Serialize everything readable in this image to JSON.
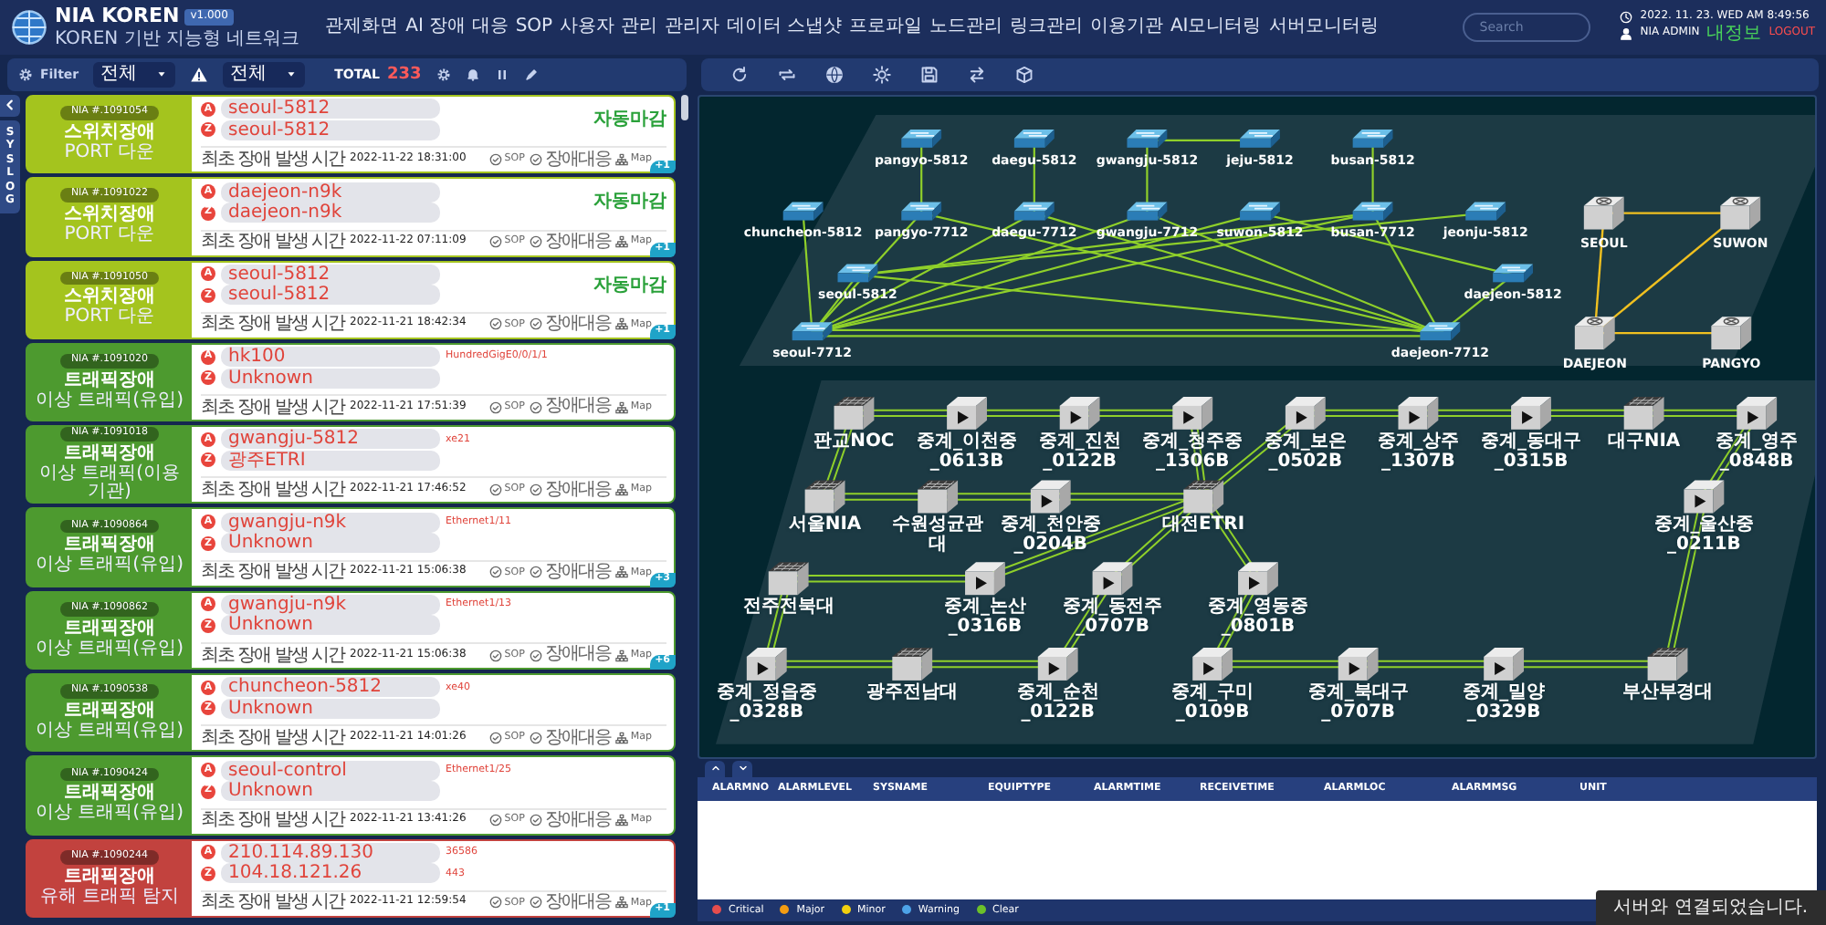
{
  "header": {
    "logo": "NIA KOREN",
    "version": "v1.000",
    "subtitle": "KOREN 기반 지능형 네트워크",
    "menu": [
      "관제화면",
      "AI 장애 대응",
      "SOP",
      "사용자 관리",
      "관리자",
      "데이터 스냅샷",
      "프로파일",
      "노드관리",
      "링크관리",
      "이용기관",
      "AI모니터링",
      "서버모니터링"
    ],
    "search": {
      "placeholder": "Search"
    },
    "datetime": "2022. 11. 23. WED AM 8:49:56",
    "user": "NIA ADMIN",
    "profile_link": "내정보",
    "logout": "LOGOUT"
  },
  "toolbar": {
    "filter": "Filter",
    "select_1": "전체",
    "select_2": "전체",
    "total_label": "TOTAL",
    "total": "233"
  },
  "sidebar": {
    "syslog": "SYSLOG"
  },
  "alarms": [
    {
      "id": "NIA #.1091054",
      "type": "스위치장애",
      "cause": "PORT 다운",
      "color": "#a4c41e",
      "endpoints": [
        {
          "marker": "A",
          "name": "seoul-5812"
        },
        {
          "marker": "Z",
          "name": "seoul-5812"
        }
      ],
      "status": "자동마감",
      "time_label": "최초 장애 발생 시간",
      "time": "2022-11-22 18:31:00",
      "actions": [
        {
          "kind": "sop",
          "label": "SOP"
        },
        {
          "kind": "response",
          "label": "장애대응"
        },
        {
          "kind": "map",
          "label": "Map"
        }
      ],
      "badge": "+1"
    },
    {
      "id": "NIA #.1091022",
      "type": "스위치장애",
      "cause": "PORT 다운",
      "color": "#a4c41e",
      "endpoints": [
        {
          "marker": "A",
          "name": "daejeon-n9k"
        },
        {
          "marker": "Z",
          "name": "daejeon-n9k"
        }
      ],
      "status": "자동마감",
      "time_label": "최초 장애 발생 시간",
      "time": "2022-11-22 07:11:09",
      "actions": [
        {
          "kind": "sop",
          "label": "SOP"
        },
        {
          "kind": "response",
          "label": "장애대응"
        },
        {
          "kind": "map",
          "label": "Map"
        }
      ],
      "badge": "+1"
    },
    {
      "id": "NIA #.1091050",
      "type": "스위치장애",
      "cause": "PORT 다운",
      "color": "#a4c41e",
      "endpoints": [
        {
          "marker": "A",
          "name": "seoul-5812"
        },
        {
          "marker": "Z",
          "name": "seoul-5812"
        }
      ],
      "status": "자동마감",
      "time_label": "최초 장애 발생 시간",
      "time": "2022-11-21 18:42:34",
      "actions": [
        {
          "kind": "sop",
          "label": "SOP"
        },
        {
          "kind": "response",
          "label": "장애대응"
        },
        {
          "kind": "map",
          "label": "Map"
        }
      ],
      "badge": "+1"
    },
    {
      "id": "NIA #.1091020",
      "type": "트래픽장애",
      "cause": "이상 트래픽(유입)",
      "color": "#4d9a2f",
      "endpoints": [
        {
          "marker": "A",
          "name": "hk100",
          "port": "HundredGigE0/0/1/1"
        },
        {
          "marker": "Z",
          "name": "Unknown"
        }
      ],
      "time_label": "최초 장애 발생 시간",
      "time": "2022-11-21 17:51:39",
      "actions": [
        {
          "kind": "sop",
          "label": "SOP"
        },
        {
          "kind": "response",
          "label": "장애대응"
        },
        {
          "kind": "map",
          "label": "Map"
        }
      ]
    },
    {
      "id": "NIA #.1091018",
      "type": "트래픽장애",
      "cause": "이상 트래픽(이용기관)",
      "color": "#4d9a2f",
      "endpoints": [
        {
          "marker": "A",
          "name": "gwangju-5812",
          "port": "xe21"
        },
        {
          "marker": "Z",
          "name": "광주ETRI"
        }
      ],
      "time_label": "최초 장애 발생 시간",
      "time": "2022-11-21 17:46:52",
      "actions": [
        {
          "kind": "sop",
          "label": "SOP"
        },
        {
          "kind": "response",
          "label": "장애대응"
        },
        {
          "kind": "map",
          "label": "Map"
        }
      ]
    },
    {
      "id": "NIA #.1090864",
      "type": "트래픽장애",
      "cause": "이상 트래픽(유입)",
      "color": "#4d9a2f",
      "endpoints": [
        {
          "marker": "A",
          "name": "gwangju-n9k",
          "port": "Ethernet1/11"
        },
        {
          "marker": "Z",
          "name": "Unknown"
        }
      ],
      "time_label": "최초 장애 발생 시간",
      "time": "2022-11-21 15:06:38",
      "actions": [
        {
          "kind": "sop",
          "label": "SOP"
        },
        {
          "kind": "response",
          "label": "장애대응"
        },
        {
          "kind": "map",
          "label": "Map"
        }
      ],
      "badge": "+3"
    },
    {
      "id": "NIA #.1090862",
      "type": "트래픽장애",
      "cause": "이상 트래픽(유입)",
      "color": "#4d9a2f",
      "endpoints": [
        {
          "marker": "A",
          "name": "gwangju-n9k",
          "port": "Ethernet1/13"
        },
        {
          "marker": "Z",
          "name": "Unknown"
        }
      ],
      "time_label": "최초 장애 발생 시간",
      "time": "2022-11-21 15:06:38",
      "actions": [
        {
          "kind": "sop",
          "label": "SOP"
        },
        {
          "kind": "response",
          "label": "장애대응"
        },
        {
          "kind": "map",
          "label": "Map"
        }
      ],
      "badge": "+6"
    },
    {
      "id": "NIA #.1090538",
      "type": "트래픽장애",
      "cause": "이상 트래픽(유입)",
      "color": "#4d9a2f",
      "endpoints": [
        {
          "marker": "A",
          "name": "chuncheon-5812",
          "port": "xe40"
        },
        {
          "marker": "Z",
          "name": "Unknown"
        }
      ],
      "time_label": "최초 장애 발생 시간",
      "time": "2022-11-21 14:01:26",
      "actions": [
        {
          "kind": "sop",
          "label": "SOP"
        },
        {
          "kind": "response",
          "label": "장애대응"
        },
        {
          "kind": "map",
          "label": "Map"
        }
      ]
    },
    {
      "id": "NIA #.1090424",
      "type": "트래픽장애",
      "cause": "이상 트래픽(유입)",
      "color": "#4d9a2f",
      "endpoints": [
        {
          "marker": "A",
          "name": "seoul-control",
          "port": "Ethernet1/25"
        },
        {
          "marker": "Z",
          "name": "Unknown"
        }
      ],
      "time_label": "최초 장애 발생 시간",
      "time": "2022-11-21 13:41:26",
      "actions": [
        {
          "kind": "sop",
          "label": "SOP"
        },
        {
          "kind": "response",
          "label": "장애대응"
        },
        {
          "kind": "map",
          "label": "Map"
        }
      ]
    },
    {
      "id": "NIA #.1090244",
      "type": "트래픽장애",
      "cause": "유해 트래픽 탐지",
      "color": "#c2423e",
      "endpoints": [
        {
          "marker": "A",
          "name": "210.114.89.130",
          "port": "36586"
        },
        {
          "marker": "Z",
          "name": "104.18.121.26",
          "port": "443"
        }
      ],
      "time_label": "최초 장애 발생 시간",
      "time": "2022-11-21 12:59:54",
      "actions": [
        {
          "kind": "sop",
          "label": "SOP"
        },
        {
          "kind": "response",
          "label": "장애대응"
        },
        {
          "kind": "map",
          "label": "Map"
        }
      ],
      "badge": "+1"
    }
  ],
  "network_map": {
    "top_plane": {
      "nodes": [
        {
          "label": "pangyo-5812",
          "kind": "switch"
        },
        {
          "label": "daegu-5812",
          "kind": "switch"
        },
        {
          "label": "gwangju-5812",
          "kind": "switch"
        },
        {
          "label": "jeju-5812",
          "kind": "switch"
        },
        {
          "label": "busan-5812",
          "kind": "switch"
        },
        {
          "label": "chuncheon-5812",
          "kind": "switch"
        },
        {
          "label": "pangyo-7712",
          "kind": "switch"
        },
        {
          "label": "daegu-7712",
          "kind": "switch"
        },
        {
          "label": "gwangju-7712",
          "kind": "switch"
        },
        {
          "label": "suwon-5812",
          "kind": "switch"
        },
        {
          "label": "busan-7712",
          "kind": "switch"
        },
        {
          "label": "jeonju-5812",
          "kind": "switch"
        },
        {
          "label": "seoul-5812",
          "kind": "switch"
        },
        {
          "label": "daejeon-5812",
          "kind": "switch"
        },
        {
          "label": "seoul-7712",
          "kind": "switch"
        },
        {
          "label": "daejeon-7712",
          "kind": "switch"
        },
        {
          "label": "SEOUL",
          "kind": "router"
        },
        {
          "label": "SUWON",
          "kind": "router"
        },
        {
          "label": "DAEJEON",
          "kind": "router"
        },
        {
          "label": "PANGYO",
          "kind": "router"
        }
      ]
    },
    "bottom_plane": {
      "nodes": [
        {
          "label": "판교NOC",
          "kind": "server"
        },
        {
          "label": "중계_이천중_0613B",
          "kind": "relay"
        },
        {
          "label": "중계_진천_0122B",
          "kind": "relay"
        },
        {
          "label": "중계_청주중_1306B",
          "kind": "relay"
        },
        {
          "label": "중계_보은_0502B",
          "kind": "relay"
        },
        {
          "label": "중계_상주_1307B",
          "kind": "relay"
        },
        {
          "label": "중계_동대구_0315B",
          "kind": "relay"
        },
        {
          "label": "대구NIA",
          "kind": "server"
        },
        {
          "label": "중계_영주_0848B",
          "kind": "relay"
        },
        {
          "label": "서울NIA",
          "kind": "server"
        },
        {
          "label": "수원성균관대",
          "kind": "server"
        },
        {
          "label": "중계_천안중_0204B",
          "kind": "relay"
        },
        {
          "label": "대전ETRI",
          "kind": "server"
        },
        {
          "label": "중계_울산중_0211B",
          "kind": "relay"
        },
        {
          "label": "전주전북대",
          "kind": "server"
        },
        {
          "label": "중계_논산_0316B",
          "kind": "relay"
        },
        {
          "label": "중계_동전주_0707B",
          "kind": "relay"
        },
        {
          "label": "중계_영동중_0801B",
          "kind": "relay"
        },
        {
          "label": "중계_정읍중_0328B",
          "kind": "relay"
        },
        {
          "label": "광주전남대",
          "kind": "server"
        },
        {
          "label": "중계_순천_0122B",
          "kind": "relay"
        },
        {
          "label": "중계_구미_0109B",
          "kind": "relay"
        },
        {
          "label": "중계_북대구_0707B",
          "kind": "relay"
        },
        {
          "label": "중계_밀양_0329B",
          "kind": "relay"
        },
        {
          "label": "부산부경대",
          "kind": "server"
        }
      ]
    }
  },
  "alarm_table": {
    "columns": [
      "ALARMNO",
      "ALARMLEVEL",
      "SYSNAME",
      "EQUIPTYPE",
      "ALARMTIME",
      "RECEIVETIME",
      "ALARMLOC",
      "ALARMMSG",
      "UNIT"
    ]
  },
  "legend": [
    {
      "label": "Critical",
      "color": "#e64d4d"
    },
    {
      "label": "Major",
      "color": "#f39c12"
    },
    {
      "label": "Minor",
      "color": "#f1d00f"
    },
    {
      "label": "Warning",
      "color": "#4da3e8"
    },
    {
      "label": "Clear",
      "color": "#6cc02a"
    }
  ],
  "toast": "서버와 연결되었습니다."
}
